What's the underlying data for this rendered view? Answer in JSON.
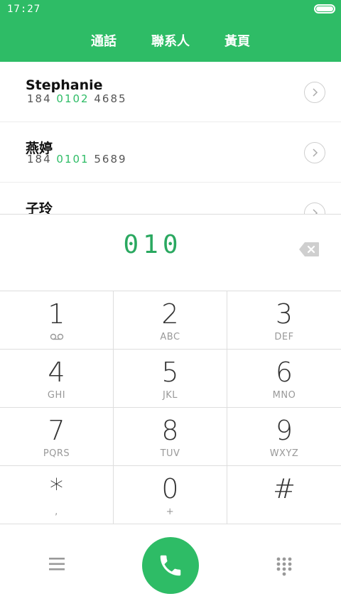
{
  "status_bar": {
    "time": "17:27"
  },
  "tabs": [
    {
      "label": "通話"
    },
    {
      "label": "聯系人"
    },
    {
      "label": "黃頁"
    }
  ],
  "contacts": [
    {
      "name": "Stephanie",
      "number_prefix": "184 ",
      "number_match": "0102",
      "number_suffix": " 4685"
    },
    {
      "name": "燕婷",
      "number_prefix": "184 ",
      "number_match": "0101",
      "number_suffix": " 5689"
    },
    {
      "name": "子玲",
      "number_prefix": "",
      "number_match": "",
      "number_suffix": ""
    }
  ],
  "dial_input": {
    "value": "010"
  },
  "keys": [
    {
      "num": "1",
      "sub": ""
    },
    {
      "num": "2",
      "sub": "ABC"
    },
    {
      "num": "3",
      "sub": "DEF"
    },
    {
      "num": "4",
      "sub": "GHI"
    },
    {
      "num": "5",
      "sub": "JKL"
    },
    {
      "num": "6",
      "sub": "MNO"
    },
    {
      "num": "7",
      "sub": "PQRS"
    },
    {
      "num": "8",
      "sub": "TUV"
    },
    {
      "num": "9",
      "sub": "WXYZ"
    },
    {
      "num": "*",
      "sub": ","
    },
    {
      "num": "0",
      "sub": "+"
    },
    {
      "num": "#",
      "sub": ""
    }
  ],
  "colors": {
    "accent": "#2ebc66",
    "digits": "#2aa860"
  },
  "icons": {
    "voicemail": "voicemail-icon",
    "backspace": "backspace-icon",
    "call": "phone-icon",
    "menu": "menu-icon",
    "dialpad": "dialpad-icon"
  }
}
